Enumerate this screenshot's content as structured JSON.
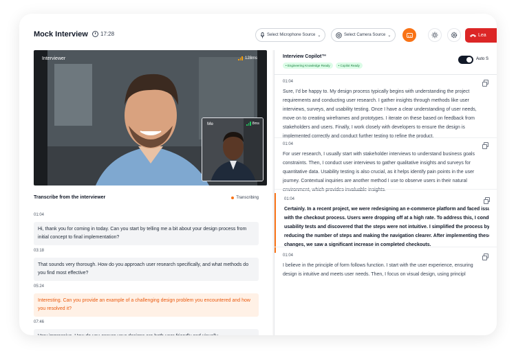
{
  "header": {
    "title": "Mock Interview",
    "timer": "17:28",
    "mic_label": "Select Microphone Source",
    "camera_label": "Select Camera Source",
    "leave_label": "Lea",
    "colors": {
      "leave": "#dc2626",
      "captions": "#f97316"
    }
  },
  "video": {
    "interviewer_label": "Interviewer",
    "interviewer_latency": "128ms",
    "self_label": "Me",
    "self_latency": "8ms"
  },
  "transcript": {
    "title": "Transcribe from the interviewer",
    "status": "Transcribing",
    "entries": [
      {
        "time": "01:04",
        "text": "Hi, thank you for coming in today. Can you start by telling me a bit about your design process from initial concept to final implementation?"
      },
      {
        "time": "03:18",
        "text": "That sounds very thorough. How do you approach user research specifically, and what methods do you find most effective?"
      },
      {
        "time": "05:24",
        "text": "Interesting. Can you provide an example of a challenging design problem you encountered and how you resolved it?"
      },
      {
        "time": "07:46",
        "text": "Very impressive. How do you ensure your designs are both user-friendly and visually"
      }
    ]
  },
  "copilot": {
    "title": "Interview Copilot™",
    "badges": [
      "Engineering Knowledge Ready",
      "Copilot Ready"
    ],
    "auto_label": "Auto S",
    "responses": [
      {
        "time": "01:04",
        "lines": [
          "Sure, I'd be happy to. My design process typically begins with understanding the project",
          "requirements and conducting user research. I gather insights through methods like user",
          "interviews, surveys, and usability testing. Once I have a clear understanding of user needs,",
          "move on to creating wireframes and prototypes. I iterate on these based on feedback from",
          "stakeholders and users. Finally, I work closely with developers to ensure the design is",
          "implemented correctly and conduct further testing to refine the product."
        ]
      },
      {
        "time": "01:04",
        "lines": [
          "For user research, I usually start with stakeholder interviews to understand business goals",
          "constraints. Then, I conduct user interviews to gather qualitative insights and surveys for",
          "quantitative data. Usability testing is also crucial, as it helps identify pain points in the user",
          "journey. Contextual inquiries are another method I use to observe users in their natural",
          "environment, which provides invaluable insights."
        ]
      },
      {
        "time": "01:04",
        "lines": [
          "Certainly. In a recent project, we were redesigning an e-commerce platform and faced issu",
          "with the checkout process. Users were dropping off at a high rate. To address this, I condu",
          "usability tests and discovered that the steps were not intuitive. I simplified the process by",
          "reducing the number of steps and making the navigation clearer. After implementing these",
          "changes, we saw a significant increase in completed checkouts."
        ]
      },
      {
        "time": "01:04",
        "lines": [
          "I believe in the principle of form follows function. I start with the user experience, ensuring",
          "design is intuitive and meets user needs. Then, I focus on visual design, using principl"
        ]
      }
    ]
  }
}
